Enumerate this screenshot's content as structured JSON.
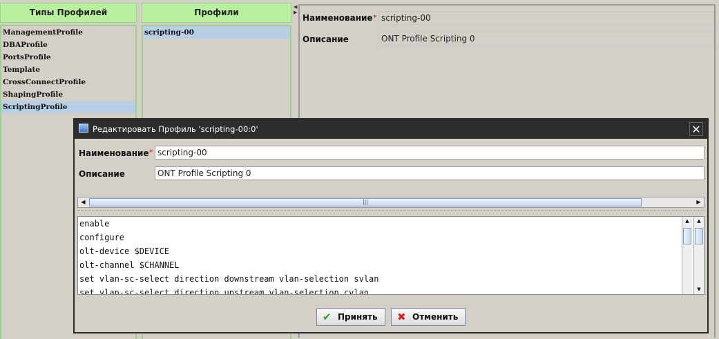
{
  "profile_types": {
    "header": "Типы Профилей",
    "items": [
      "ManagementProfile",
      "DBAProfile",
      "PortsProfile",
      "Template",
      "CrossConnectProfile",
      "ShapingProfile",
      "ScriptingProfile"
    ],
    "selected_index": 6
  },
  "profiles": {
    "header": "Профили",
    "items": [
      "scripting-00"
    ],
    "selected_index": 0
  },
  "details": {
    "name_label": "Наименование",
    "required_mark": "*",
    "name_value": "scripting-00",
    "desc_label": "Описание",
    "desc_value": "ONT Profile Scripting 0"
  },
  "dialog": {
    "title": "Редактировать Профиль 'scripting-00:0'",
    "close_glyph": "✕",
    "name_label": "Наименование",
    "required_mark": "*",
    "name_value": "scripting-00",
    "desc_label": "Описание",
    "desc_value": "ONT Profile Scripting 0",
    "script_lines": [
      "enable",
      "configure",
      "olt-device $DEVICE",
      "olt-channel $CHANNEL",
      "set vlan-sc-select direction downstream vlan-selection svlan",
      "set vlan-sc-select direction upstream vlan-selection cvlan"
    ],
    "accept_label": "Принять",
    "accept_icon": "check-icon",
    "cancel_label": "Отменить",
    "cancel_icon": "cross-icon",
    "accept_color": "#2e9a2e",
    "cancel_color": "#d42020"
  }
}
